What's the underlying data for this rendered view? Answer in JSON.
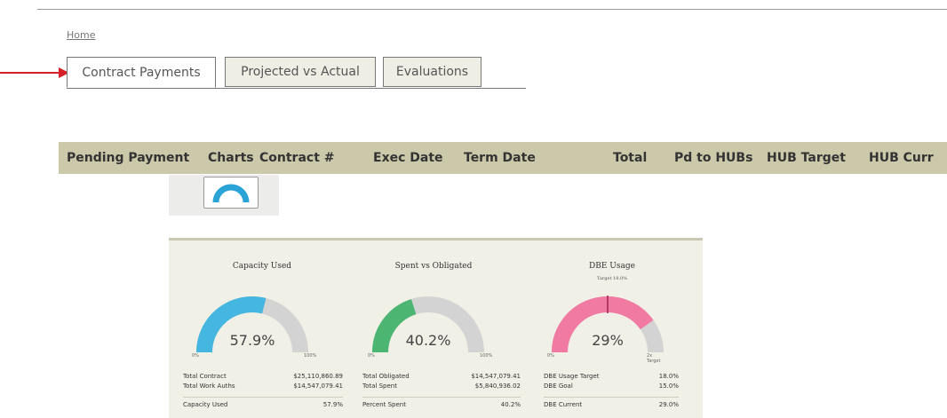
{
  "breadcrumb": {
    "home": "Home"
  },
  "tabs": [
    {
      "label": "Contract Payments",
      "active": true
    },
    {
      "label": "Projected vs Actual",
      "active": false
    },
    {
      "label": "Evaluations",
      "active": false
    }
  ],
  "table": {
    "columns": [
      "Pending Payment",
      "Charts",
      "Contract #",
      "Exec Date",
      "Term Date",
      "Total",
      "Pd to HUBs",
      "HUB Target",
      "HUB Curr"
    ]
  },
  "charts_button": {
    "icon": "gauge-icon"
  },
  "gauges": [
    {
      "title": "Capacity Used",
      "subtitle": "",
      "value_label": "57.9%",
      "fraction": 0.579,
      "color": "#45b6df",
      "min_label": "0%",
      "max_label": "100%",
      "rows": [
        {
          "label": "Total Contract",
          "value": "$25,110,860.89"
        },
        {
          "label": "Total Work Auths",
          "value": "$14,547,079.41"
        }
      ],
      "footer": {
        "label": "Capacity Used",
        "value": "57.9%"
      }
    },
    {
      "title": "Spent vs Obligated",
      "subtitle": "",
      "value_label": "40.2%",
      "fraction": 0.402,
      "color": "#4cb571",
      "min_label": "0%",
      "max_label": "100%",
      "rows": [
        {
          "label": "Total Obligated",
          "value": "$14,547,079.41"
        },
        {
          "label": "Total Spent",
          "value": "$5,840,936.02"
        }
      ],
      "footer": {
        "label": "Percent Spent",
        "value": "40.2%"
      }
    },
    {
      "title": "DBE Usage",
      "subtitle": "Target 18.0%",
      "value_label": "29%",
      "fraction": 0.805,
      "target_fraction": 0.5,
      "color": "#f17aa3",
      "min_label": "0%",
      "max_label": "2x Target",
      "rows": [
        {
          "label": "DBE Usage Target",
          "value": "18.0%"
        },
        {
          "label": "DBE Goal",
          "value": "15.0%"
        }
      ],
      "footer": {
        "label": "DBE Current",
        "value": "29.0%"
      }
    }
  ],
  "colors": {
    "header_bg": "#cbc9aa",
    "arrow": "#d61f26",
    "gauge_track": "#d3d3d3"
  }
}
